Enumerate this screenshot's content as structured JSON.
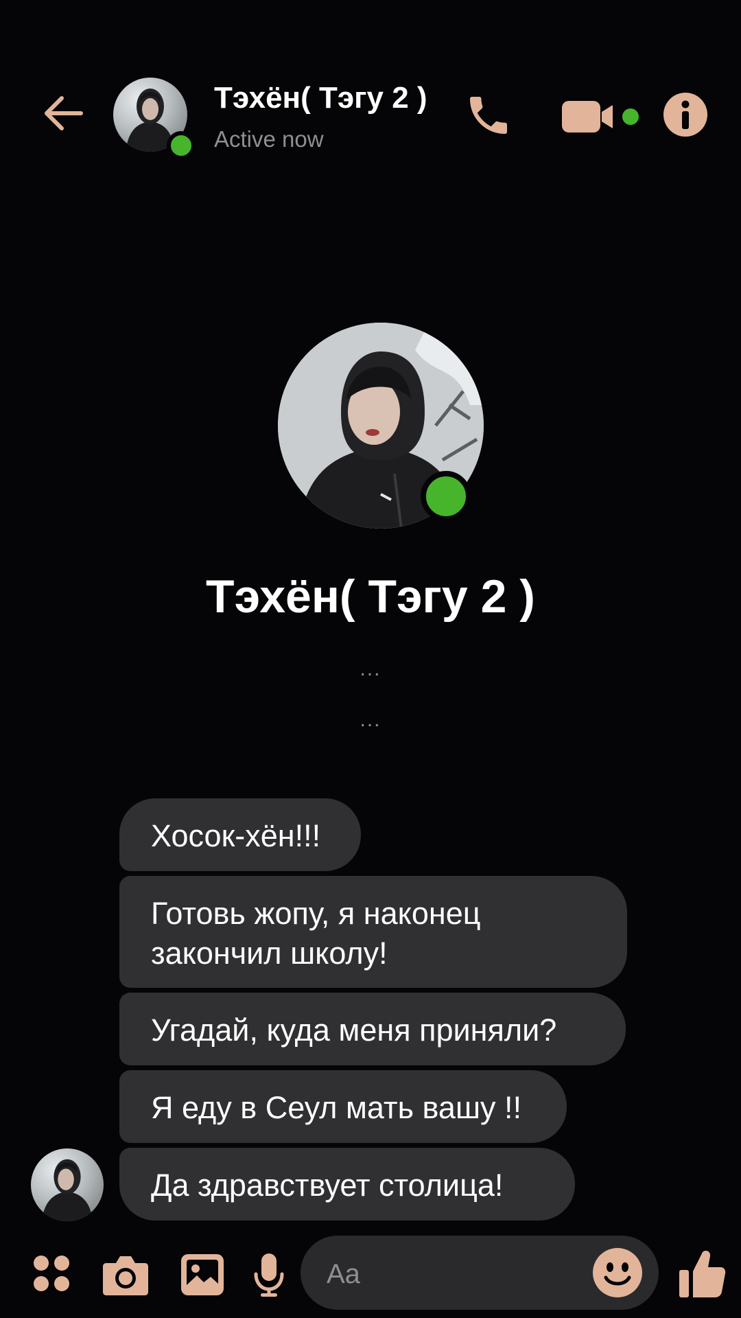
{
  "theme": {
    "accent": "#e2b59a",
    "online": "#46b52c",
    "background": "#050406",
    "bubble": "#303033"
  },
  "header": {
    "back_icon": "arrow-left-icon",
    "contact_name": "Тэхён( Тэгу 2 )",
    "status": "Active now",
    "call_icon": "phone-icon",
    "video_icon": "video-camera-icon",
    "info_icon": "info-icon"
  },
  "profile": {
    "name": "Тэхён( Тэгу 2 )",
    "line1": "...",
    "line2": "..."
  },
  "messages": [
    {
      "text": "Хосок-хён!!!"
    },
    {
      "text": "Готовь жопу, я наконец закончил школу!"
    },
    {
      "text": "Угадай, куда меня приняли?"
    },
    {
      "text": "Я еду в Сеул мать вашу !!"
    },
    {
      "text": "Да здравствует столица!"
    }
  ],
  "composer": {
    "menu_icon": "four-dots-menu-icon",
    "camera_icon": "camera-icon",
    "gallery_icon": "image-icon",
    "mic_icon": "microphone-icon",
    "placeholder": "Aa",
    "emoji_icon": "smiley-icon",
    "like_icon": "thumbs-up-icon"
  }
}
